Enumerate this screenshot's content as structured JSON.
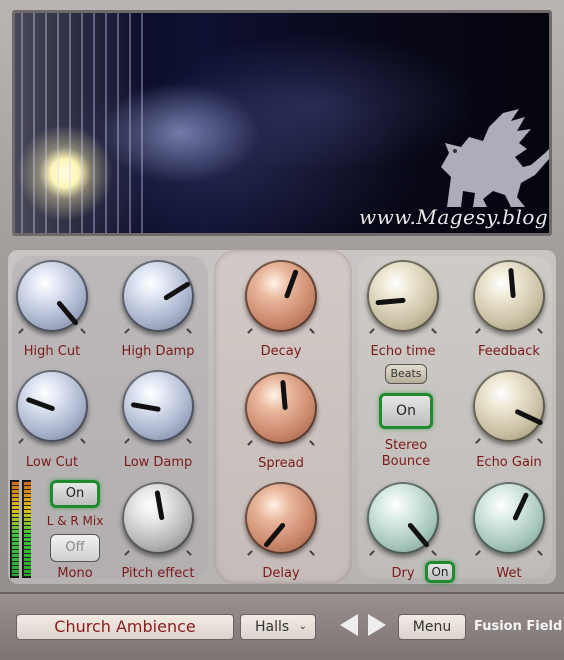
{
  "header": {
    "watermark": "www.Magesy.blog"
  },
  "left": {
    "knobs": [
      {
        "label": "High Cut",
        "color": "#a9b3cb",
        "angle": 140
      },
      {
        "label": "High Damp",
        "color": "#a9b3cb",
        "angle": 58
      },
      {
        "label": "Low Cut",
        "color": "#a9b3cb",
        "angle": -70
      },
      {
        "label": "Low Damp",
        "color": "#a9b3cb",
        "angle": -80
      },
      {
        "label": "Pitch effect",
        "color": "#b3b3b3",
        "angle": -10
      }
    ],
    "lr_mix": {
      "button": "On",
      "label": "L & R Mix"
    },
    "mono": {
      "button": "Off",
      "label": "Mono"
    }
  },
  "middle": {
    "knobs": [
      {
        "label": "Decay",
        "color": "#c9866a",
        "angle": 20
      },
      {
        "label": "Spread",
        "color": "#c9866a",
        "angle": -5
      },
      {
        "label": "Delay",
        "color": "#c9866a",
        "angle": -140
      }
    ]
  },
  "right": {
    "knobs": [
      {
        "label": "Echo time",
        "color": "#c8bfa3",
        "angle": -95
      },
      {
        "label": "Feedback",
        "color": "#c8bfa3",
        "angle": -5
      },
      {
        "label": "Echo Gain",
        "color": "#c8bfa3",
        "angle": 115
      },
      {
        "label": "Dry",
        "color": "#a6c6bc",
        "angle": 140
      },
      {
        "label": "Wet",
        "color": "#a6c6bc",
        "angle": 25
      }
    ],
    "beats": "Beats",
    "stereo_bounce": {
      "button": "On",
      "label_line1": "Stereo",
      "label_line2": "Bounce"
    },
    "dry_on": "On"
  },
  "bottom": {
    "preset_name": "Church Ambience",
    "category": "Halls",
    "menu": "Menu",
    "brand": "Fusion Field"
  }
}
